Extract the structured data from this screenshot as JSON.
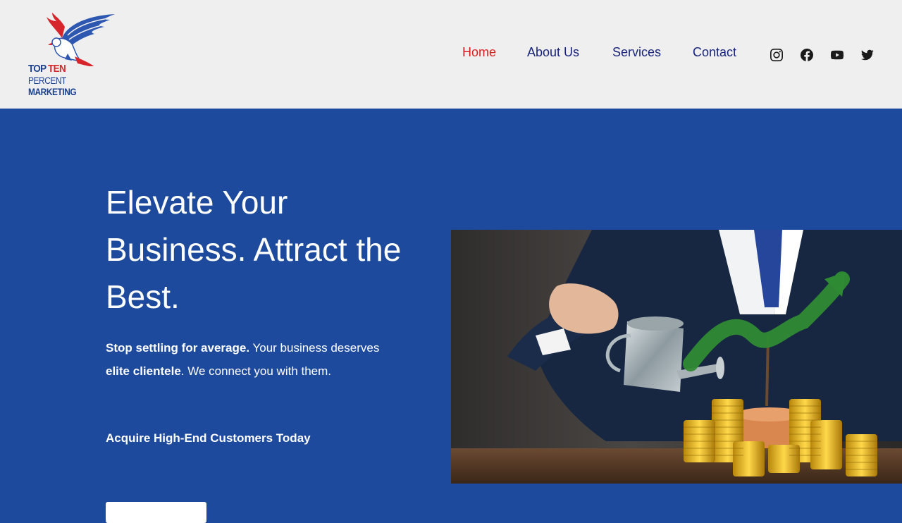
{
  "logo": {
    "line1_part1": "TOP",
    "line1_part2": "TEN",
    "line2": "PERCENT",
    "line3": "MARKETING"
  },
  "nav": {
    "items": [
      {
        "label": "Home",
        "active": true
      },
      {
        "label": "About Us",
        "active": false
      },
      {
        "label": "Services",
        "active": false
      },
      {
        "label": "Contact",
        "active": false
      }
    ]
  },
  "social": {
    "icons": [
      "instagram-icon",
      "facebook-icon",
      "youtube-icon",
      "twitter-icon"
    ]
  },
  "hero": {
    "title": "Elevate Your Business. Attract the Best.",
    "desc_bold1": "Stop settling for average.",
    "desc_text1": " Your business deserves ",
    "desc_bold2": "elite clientele",
    "desc_text2": ". We connect you with them.",
    "cta_text": "Acquire High-End Customers Today"
  },
  "colors": {
    "hero_bg": "#1e4a9e",
    "header_bg": "#efefef",
    "nav_active": "#d71f1f",
    "nav_text": "#18237a"
  }
}
